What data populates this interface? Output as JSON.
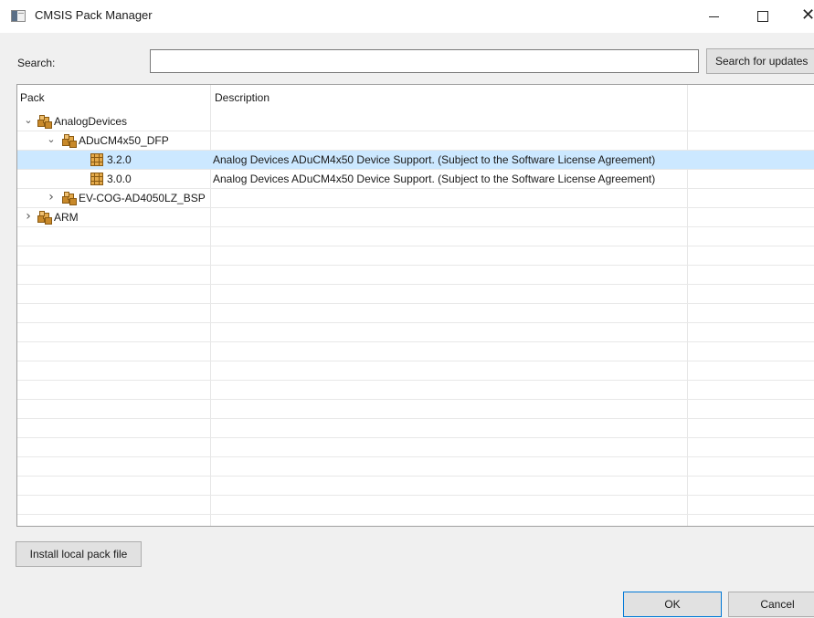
{
  "window": {
    "title": "CMSIS Pack Manager",
    "close_glyph": "✕"
  },
  "search": {
    "label": "Search:",
    "value": "",
    "placeholder": "",
    "button_label": "Search for updates"
  },
  "table": {
    "columns": [
      "Pack",
      "Description"
    ],
    "rows": [
      {
        "level": 0,
        "expand": "down",
        "icon": "package-icon",
        "pack": "AnalogDevices",
        "description": "",
        "selected": false
      },
      {
        "level": 1,
        "expand": "down",
        "icon": "package-icon",
        "pack": "ADuCM4x50_DFP",
        "description": "",
        "selected": false
      },
      {
        "level": 2,
        "expand": "",
        "icon": "pack-version-icon",
        "pack": "3.2.0",
        "description": "Analog Devices ADuCM4x50 Device Support. (Subject to the Software License Agreement)",
        "selected": true
      },
      {
        "level": 2,
        "expand": "",
        "icon": "pack-version-icon",
        "pack": "3.0.0",
        "description": "Analog Devices ADuCM4x50 Device Support. (Subject to the Software License Agreement)",
        "selected": false
      },
      {
        "level": 1,
        "expand": "right",
        "icon": "package-icon",
        "pack": "EV-COG-AD4050LZ_BSP",
        "description": "",
        "selected": false
      },
      {
        "level": 0,
        "expand": "right",
        "icon": "package-icon",
        "pack": "ARM",
        "description": "",
        "selected": false
      }
    ]
  },
  "buttons": {
    "install_local": "Install local pack file",
    "ok": "OK",
    "cancel": "Cancel"
  },
  "colors": {
    "selection": "#cce8ff",
    "package_icon": "#c8892a",
    "focus_border": "#0078d7"
  }
}
